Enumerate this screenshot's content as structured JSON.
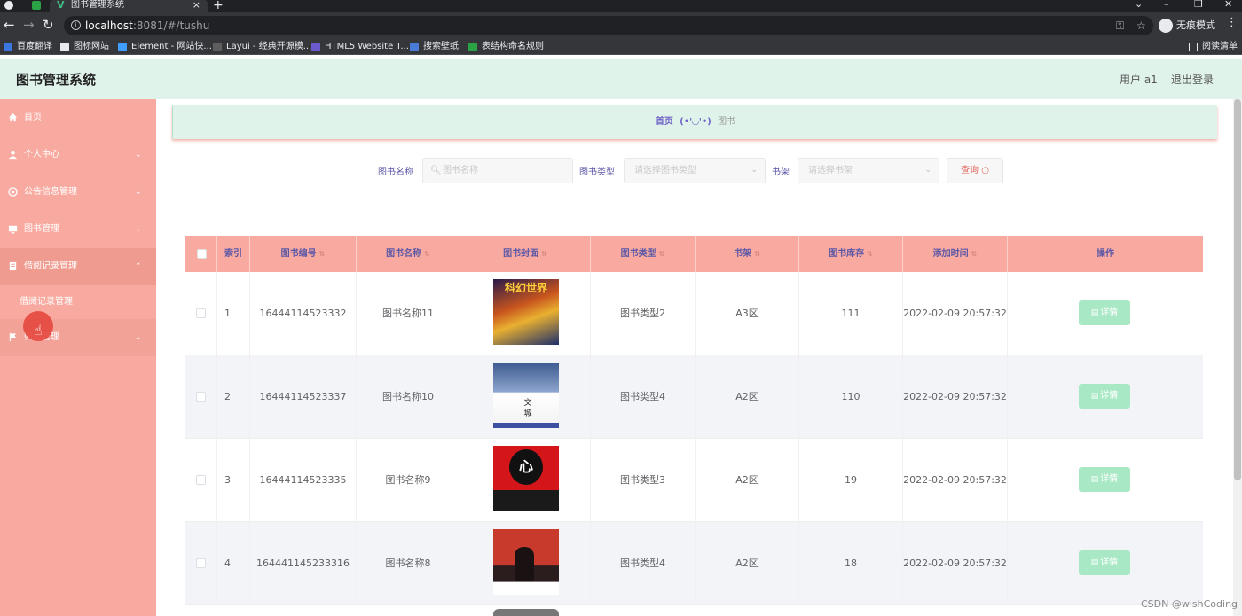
{
  "browser": {
    "tab_title": "图书管理系统",
    "url_host": "localhost",
    "url_path": ":8081/#/tushu",
    "incognito_label": "无痕模式",
    "reading_list": "阅读清单",
    "bookmarks": [
      "百度翻译",
      "图标网站",
      "Element - 网站快...",
      "Layui - 经典开源模...",
      "HTML5 Website T...",
      "搜索壁纸",
      "表结构命名规则"
    ]
  },
  "header": {
    "title": "图书管理系统",
    "user": "用户 a1",
    "logout": "退出登录"
  },
  "sidebar": {
    "items": [
      {
        "label": "首页"
      },
      {
        "label": "个人中心"
      },
      {
        "label": "公告信息管理"
      },
      {
        "label": "图书管理"
      },
      {
        "label": "借阅记录管理"
      },
      {
        "label": "借阅记录管理"
      },
      {
        "label": "归还管理"
      }
    ]
  },
  "breadcrumb": {
    "home": "首页",
    "separator": "(•'◡'•)",
    "current": "图书"
  },
  "search": {
    "name_label": "图书名称",
    "name_placeholder": "图书名称",
    "type_label": "图书类型",
    "type_placeholder": "请选择图书类型",
    "shelf_label": "书架",
    "shelf_placeholder": "请选择书架",
    "query_button": "查询"
  },
  "table": {
    "columns": [
      "索引",
      "图书编号",
      "图书名称",
      "图书封面",
      "图书类型",
      "书架",
      "图书库存",
      "添加时间",
      "操作"
    ],
    "rows": [
      {
        "index": "1",
        "code": "16444114523332",
        "name": "图书名称11",
        "type": "图书类型2",
        "shelf": "A3区",
        "stock": "111",
        "time": "2022-02-09 20:57:32",
        "cover_text": "科幻世界"
      },
      {
        "index": "2",
        "code": "16444114523337",
        "name": "图书名称10",
        "type": "图书类型4",
        "shelf": "A2区",
        "stock": "110",
        "time": "2022-02-09 20:57:32",
        "cover_text": "文城"
      },
      {
        "index": "3",
        "code": "16444114523335",
        "name": "图书名称9",
        "type": "图书类型3",
        "shelf": "A2区",
        "stock": "19",
        "time": "2022-02-09 20:57:32",
        "cover_text": "心"
      },
      {
        "index": "4",
        "code": "164441145233316",
        "name": "图书名称8",
        "type": "图书类型4",
        "shelf": "A2区",
        "stock": "18",
        "time": "2022-02-09 20:57:32",
        "cover_text": ""
      }
    ],
    "action_label": "详情"
  },
  "watermark": "CSDN @wishCoding",
  "colors": {
    "header_bg": "#dff3ea",
    "sidebar_bg": "#f8aaa0",
    "table_header_bg": "#f8aaa0",
    "detail_button": "#a9e8c5",
    "accent_text": "#5b57a7"
  }
}
